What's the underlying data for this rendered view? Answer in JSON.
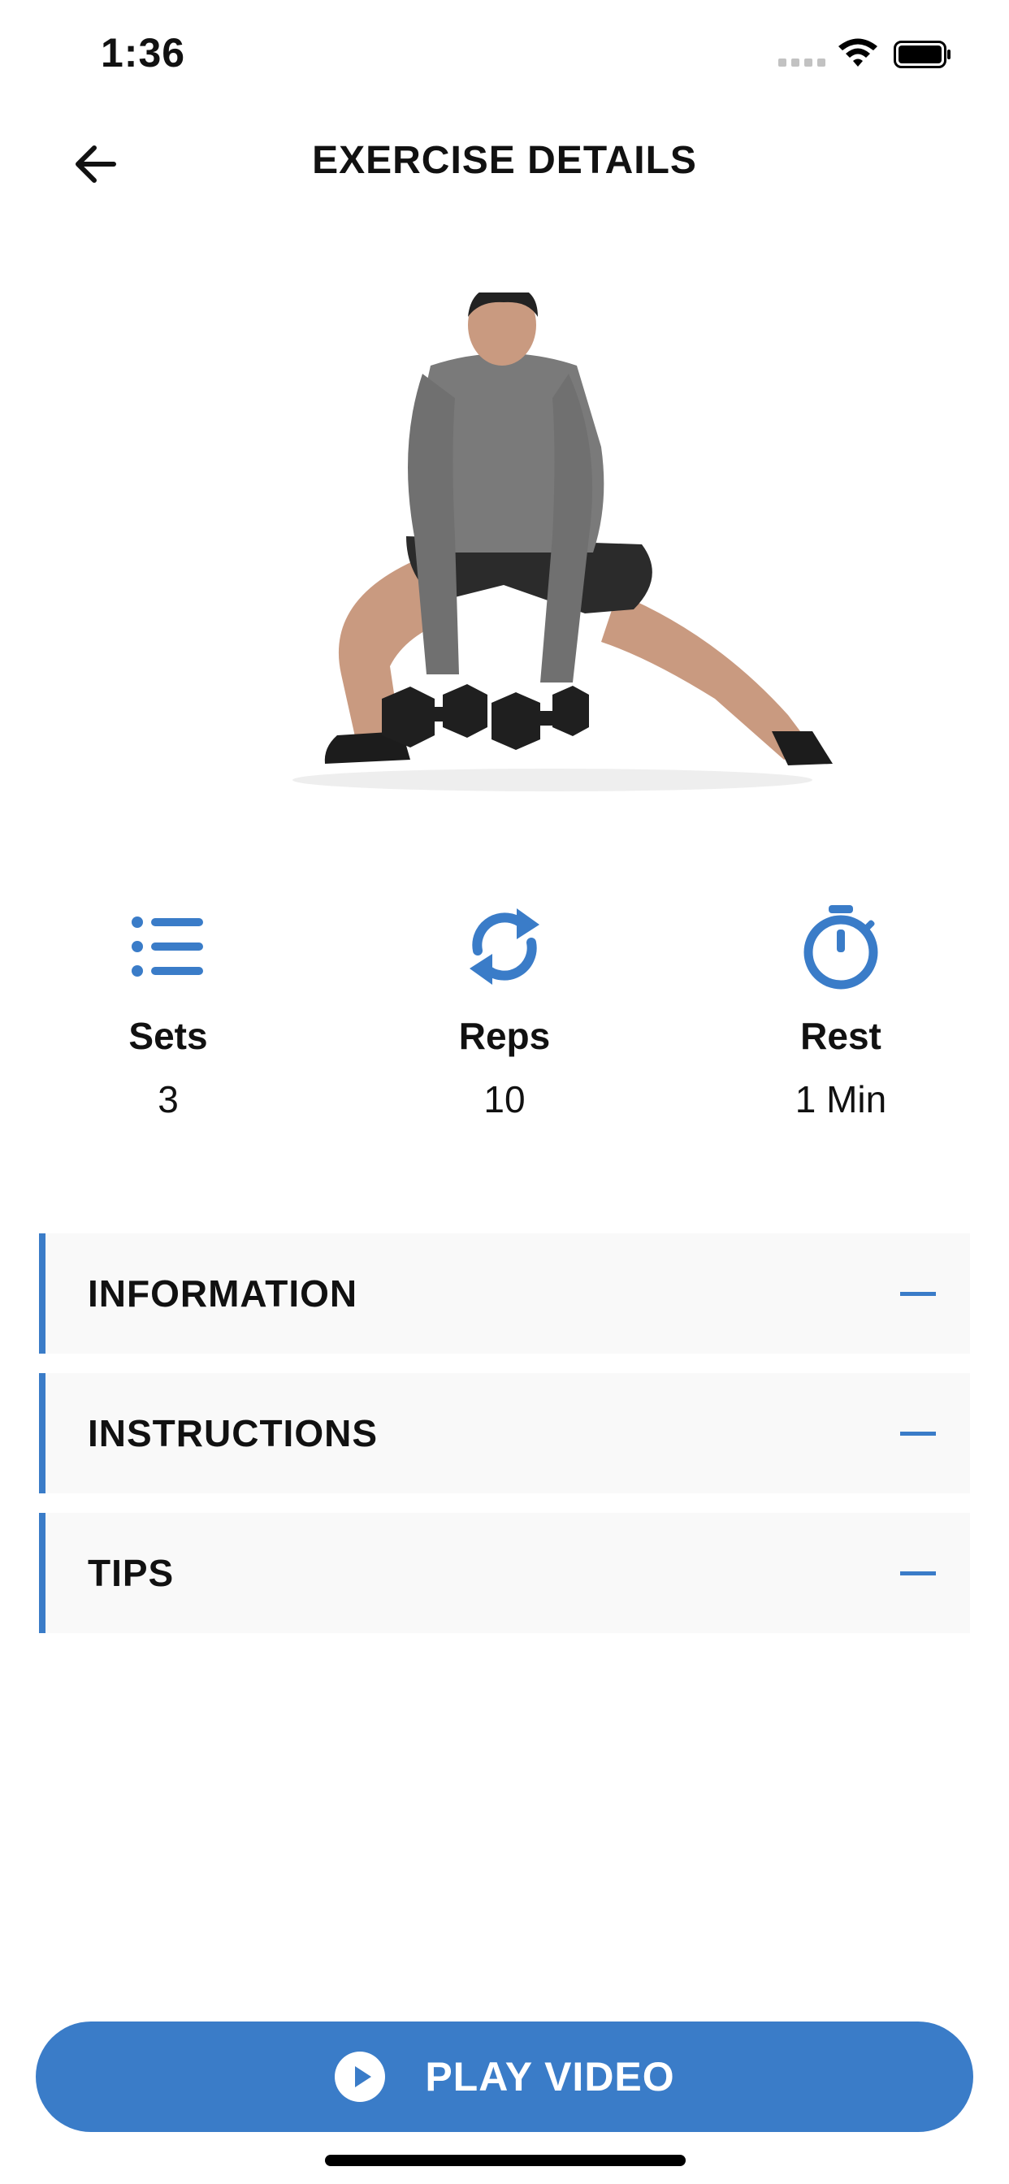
{
  "status_bar": {
    "time": "1:36"
  },
  "header": {
    "title": "EXERCISE DETAILS",
    "back_icon": "arrow-left-icon"
  },
  "hero": {
    "image": "exercise-demo-image"
  },
  "stats": [
    {
      "icon": "list-icon",
      "label": "Sets",
      "value": "3"
    },
    {
      "icon": "repeat-icon",
      "label": "Reps",
      "value": "10"
    },
    {
      "icon": "stopwatch-icon",
      "label": "Rest",
      "value": "1 Min"
    }
  ],
  "sections": [
    {
      "label": "INFORMATION",
      "toggle_icon": "minus-icon"
    },
    {
      "label": "INSTRUCTIONS",
      "toggle_icon": "minus-icon"
    },
    {
      "label": "TIPS",
      "toggle_icon": "minus-icon"
    }
  ],
  "play_button": {
    "label": "PLAY VIDEO",
    "icon": "play-circle-icon"
  },
  "colors": {
    "accent": "#3a7cc8",
    "section_background": "#f9f9f9",
    "text": "#111111"
  }
}
